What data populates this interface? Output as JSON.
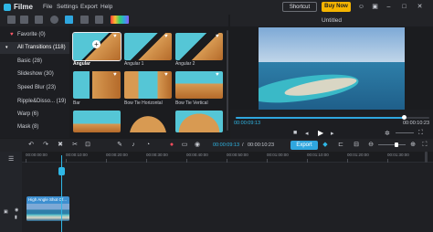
{
  "app": {
    "name": "Filme",
    "menu": [
      "File",
      "Settings",
      "Export",
      "Help"
    ],
    "shortcut_label": "Shortcut",
    "buy_label": "Buy Now"
  },
  "sidebar": {
    "items": [
      {
        "label": "Favorite (0)",
        "icon": "heart-icon"
      },
      {
        "label": "All Transitions (118)",
        "icon": "chevron-down-icon"
      },
      {
        "label": "Basic (28)"
      },
      {
        "label": "Slideshow (30)"
      },
      {
        "label": "Speed Blur (23)"
      },
      {
        "label": "Ripple&Disso... (19)"
      },
      {
        "label": "Warp (6)"
      },
      {
        "label": "Mask (8)"
      }
    ]
  },
  "transitions": [
    {
      "label": "Angular"
    },
    {
      "label": "Angular 1"
    },
    {
      "label": "Angular 2"
    },
    {
      "label": "Bar"
    },
    {
      "label": "Bow Tie Horizontal"
    },
    {
      "label": "Bow Tie Vertical"
    },
    {
      "label": ""
    },
    {
      "label": ""
    },
    {
      "label": ""
    }
  ],
  "preview": {
    "title": "Untitled",
    "current_time": "00:00:09:13",
    "total_time": "00:00:10:23",
    "progress": 0.87
  },
  "timeline": {
    "current": "00:00:09:13",
    "total": "00:00:10:23",
    "export_label": "Export",
    "ticks": [
      "00:00:00:00",
      "00:00:10:00",
      "00:00:20:00",
      "00:00:30:00",
      "00:00:40:00",
      "00:00:50:00",
      "00:01:00:00",
      "00:01:10:00",
      "00:01:20:00",
      "00:01:30:00"
    ],
    "clip_title": "High Angle Shot Of..."
  }
}
